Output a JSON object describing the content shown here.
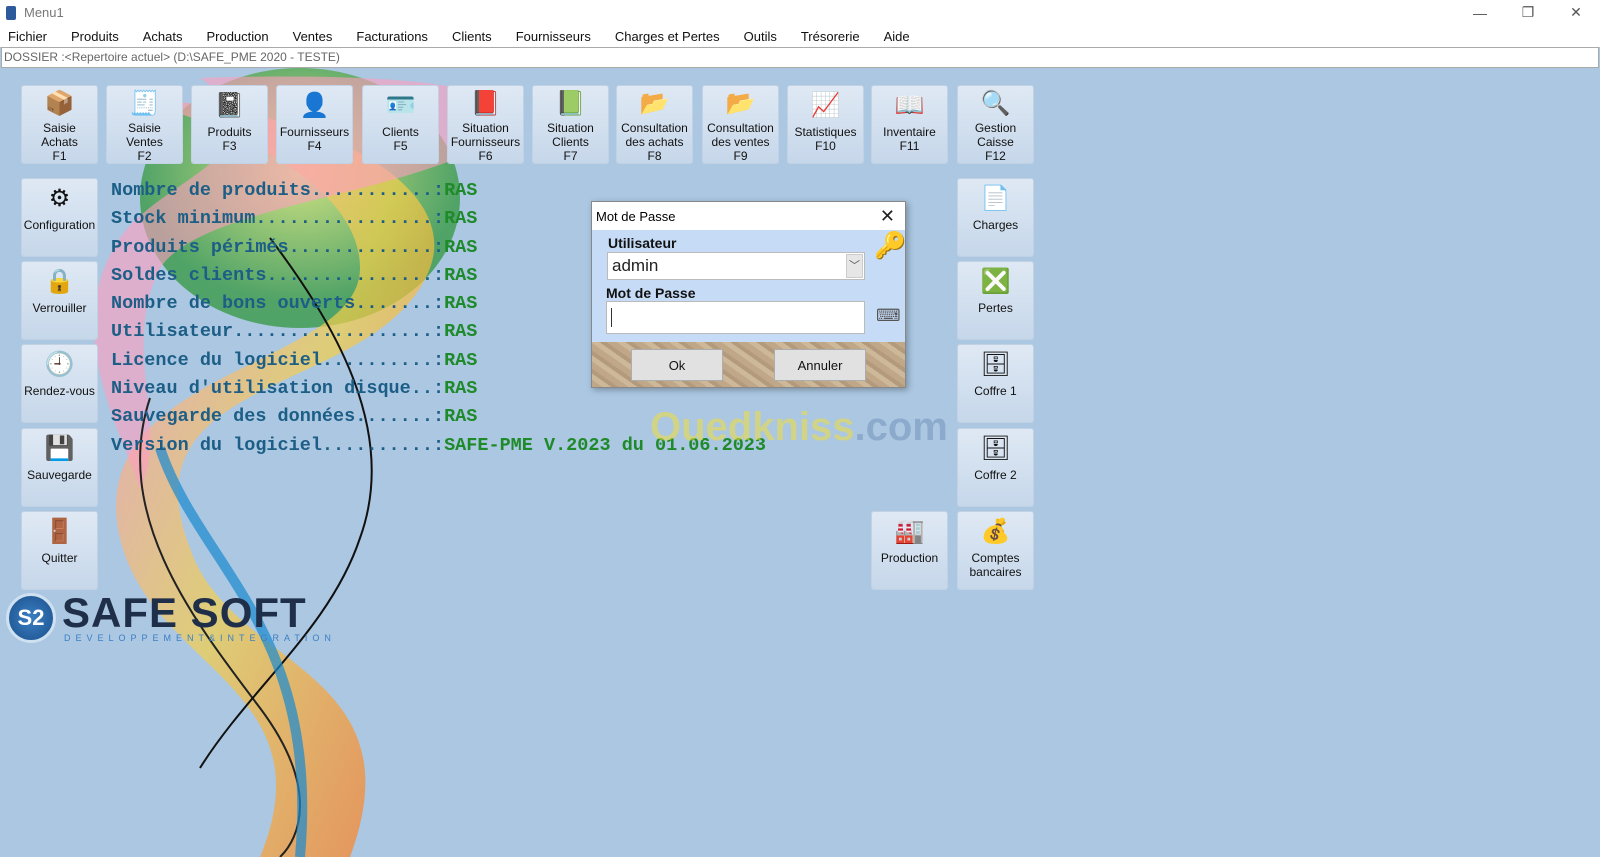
{
  "window": {
    "title": "Menu1",
    "controls": [
      "—",
      "❐",
      "✕"
    ]
  },
  "menu": [
    "Fichier",
    "Produits",
    "Achats",
    "Production",
    "Ventes",
    "Facturations",
    "Clients",
    "Fournisseurs",
    "Charges et Pertes",
    "Outils",
    "Trésorerie",
    "Aide"
  ],
  "dossier": "DOSSIER :<Repertoire actuel> (D:\\SAFE_PME 2020 - TESTE)",
  "top_tiles": [
    {
      "l1": "Saisie",
      "l2": "Achats",
      "l3": "F1",
      "icon": "box-icon",
      "g": "📦"
    },
    {
      "l1": "Saisie",
      "l2": "Ventes",
      "l3": "F2",
      "icon": "register-icon",
      "g": "🧾"
    },
    {
      "l1": "Produits",
      "l2": "F3",
      "l3": "",
      "icon": "book-icon",
      "g": "📓"
    },
    {
      "l1": "Fournisseurs",
      "l2": "F4",
      "l3": "",
      "icon": "person-icon",
      "g": "👤"
    },
    {
      "l1": "Clients",
      "l2": "F5",
      "l3": "",
      "icon": "contact-card-icon",
      "g": "🪪"
    },
    {
      "l1": "Situation",
      "l2": "Fournisseurs",
      "l3": "F6",
      "icon": "red-book-icon",
      "g": "📕"
    },
    {
      "l1": "Situation",
      "l2": "Clients",
      "l3": "F7",
      "icon": "green-book-icon",
      "g": "📗"
    },
    {
      "l1": "Consultation",
      "l2": "des achats",
      "l3": "F8",
      "icon": "folder-icon",
      "g": "📂"
    },
    {
      "l1": "Consultation",
      "l2": "des ventes",
      "l3": "F9",
      "icon": "folder-icon",
      "g": "📂"
    },
    {
      "l1": "Statistiques",
      "l2": "F10",
      "l3": "",
      "icon": "chart-icon",
      "g": "📈"
    },
    {
      "l1": "Inventaire",
      "l2": "F11",
      "l3": "",
      "icon": "open-book-icon",
      "g": "📖"
    },
    {
      "l1": "Gestion",
      "l2": "Caisse",
      "l3": "F12",
      "icon": "magnifier-icon",
      "g": "🔍"
    }
  ],
  "left_tiles": [
    {
      "label": "Configuration",
      "icon": "settings-icon",
      "g": "⚙"
    },
    {
      "label": "Verrouiller",
      "icon": "lock-icon",
      "g": "🔒"
    },
    {
      "label": "Rendez-vous",
      "icon": "clock-icon",
      "g": "🕘"
    },
    {
      "label": "Sauvegarde",
      "icon": "floppy-icon",
      "g": "💾"
    },
    {
      "label": "Quitter",
      "icon": "exit-door-icon",
      "g": "🚪"
    }
  ],
  "right_tiles": [
    {
      "l1": "Charges",
      "l2": "",
      "icon": "document-icon",
      "g": "📄"
    },
    {
      "l1": "Pertes",
      "l2": "",
      "icon": "box-cross-icon",
      "g": "❎"
    },
    {
      "l1": "Coffre 1",
      "l2": "",
      "icon": "safe-icon",
      "g": "🗄"
    },
    {
      "l1": "Coffre 2",
      "l2": "",
      "icon": "safe-icon",
      "g": "🗄"
    },
    {
      "l1": "Comptes",
      "l2": "bancaires",
      "icon": "money-bag-icon",
      "g": "💰"
    }
  ],
  "production_tile": {
    "label": "Production",
    "icon": "forklift-icon",
    "g": "🏭"
  },
  "info": [
    {
      "label": "Nombre de produits...........:",
      "value": "RAS"
    },
    {
      "label": "Stock minimum................:",
      "value": "RAS"
    },
    {
      "label": "Produits périmés.............:",
      "value": "RAS"
    },
    {
      "label": "Soldes clients...............:",
      "value": "RAS"
    },
    {
      "label": "Nombre de bons ouverts.......:",
      "value": "RAS"
    },
    {
      "label": "Utilisateur..................:",
      "value": "RAS"
    },
    {
      "label": "Licence du logiciel..........:",
      "value": "RAS"
    },
    {
      "label": "Niveau d'utilisation disque..:",
      "value": "RAS"
    },
    {
      "label": "Sauvegarde des données.......:",
      "value": "RAS"
    },
    {
      "label": "Version du logiciel..........:",
      "value": "SAFE-PME V.2023 du 01.06.2023"
    }
  ],
  "dialog": {
    "title": "Mot de Passe",
    "user_label": "Utilisateur",
    "user_value": "admin",
    "password_label": "Mot de Passe",
    "password_value": "",
    "ok": "Ok",
    "cancel": "Annuler"
  },
  "logo": {
    "name": "SAFE SOFT",
    "sub": "DEVELOPPEMENT&INTEGRATION",
    "mark": "S2"
  },
  "watermark": {
    "a": "Ouedkniss",
    ".b": ".com",
    "b": ".com"
  }
}
